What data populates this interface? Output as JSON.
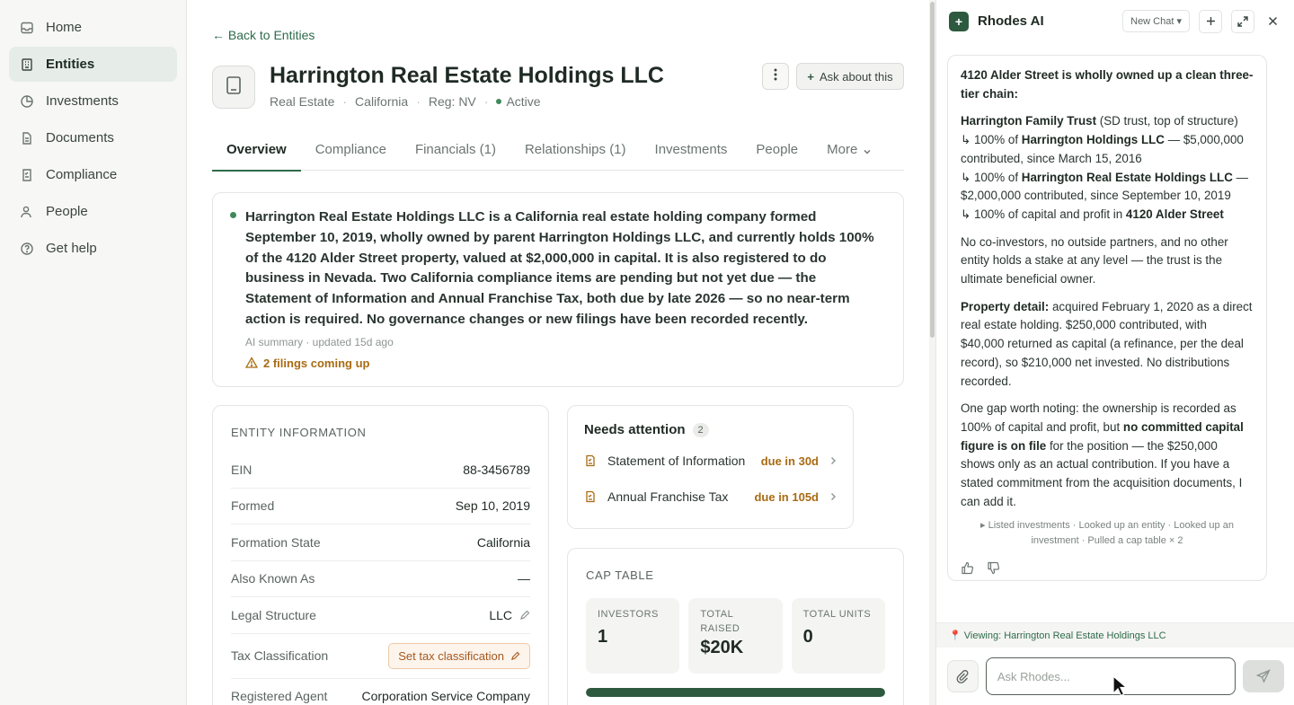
{
  "sidebar": {
    "items": [
      {
        "label": "Home",
        "icon": "inbox-icon"
      },
      {
        "label": "Entities",
        "icon": "building-icon"
      },
      {
        "label": "Investments",
        "icon": "pie-chart-icon"
      },
      {
        "label": "Documents",
        "icon": "document-icon"
      },
      {
        "label": "Compliance",
        "icon": "checklist-icon"
      },
      {
        "label": "People",
        "icon": "people-icon"
      },
      {
        "label": "Get help",
        "icon": "help-icon"
      }
    ],
    "active": "Entities"
  },
  "header": {
    "back_link": "← Back to Entities",
    "title": "Harrington Real Estate Holdings LLC",
    "meta": {
      "category": "Real Estate",
      "state": "California",
      "registration": "Reg: NV",
      "status": "Active"
    },
    "ask_button": "Ask about this"
  },
  "tabs": [
    {
      "label": "Overview"
    },
    {
      "label": "Compliance"
    },
    {
      "label": "Financials (1)"
    },
    {
      "label": "Relationships (1)"
    },
    {
      "label": "Investments"
    },
    {
      "label": "People"
    },
    {
      "label": "More"
    }
  ],
  "summary": {
    "text": "Harrington Real Estate Holdings LLC is a California real estate holding company formed September 10, 2019, wholly owned by parent Harrington Holdings LLC, and currently holds 100% of the 4120 Alder Street property, valued at $2,000,000 in capital. It is also registered to do business in Nevada. Two California compliance items are pending but not yet due — the Statement of Information and Annual Franchise Tax, both due by late 2026 — so no near-term action is required. No governance changes or new filings have been recorded recently.",
    "updated": "AI summary · updated 15d ago",
    "warning": "2 filings coming up"
  },
  "entity_info": {
    "heading": "ENTITY INFORMATION",
    "rows": [
      {
        "key": "EIN",
        "value": "88-3456789"
      },
      {
        "key": "Formed",
        "value": "Sep 10, 2019"
      },
      {
        "key": "Formation State",
        "value": "California"
      },
      {
        "key": "Also Known As",
        "value": "—"
      },
      {
        "key": "Legal Structure",
        "value": "LLC"
      },
      {
        "key": "Tax Classification",
        "value": "Set tax classification"
      },
      {
        "key": "Registered Agent",
        "value": "Corporation Service Company"
      }
    ]
  },
  "attention": {
    "title": "Needs attention",
    "count": "2",
    "items": [
      {
        "label": "Statement of Information",
        "due": "due in 30d"
      },
      {
        "label": "Annual Franchise Tax",
        "due": "due in 105d"
      }
    ]
  },
  "cap_table": {
    "heading": "CAP TABLE",
    "stats": [
      {
        "label": "INVESTORS",
        "value": "1"
      },
      {
        "label": "TOTAL RAISED",
        "value": "$20K"
      },
      {
        "label": "TOTAL UNITS",
        "value": "0"
      }
    ],
    "progress_percent": 100
  },
  "chat": {
    "title": "Rhodes AI",
    "new_chat": "New Chat ▾",
    "message": {
      "intro": "4120 Alder Street is wholly owned up a clean three-tier chain:",
      "chain": [
        {
          "pre": "",
          "bold": "Harrington Family Trust",
          "post": " (SD trust, top of structure)"
        },
        {
          "pre": "↳ 100% of ",
          "bold": "Harrington Holdings LLC",
          "post": " — $5,000,000 contributed, since March 15, 2016"
        },
        {
          "pre": "↳ 100% of ",
          "bold": "Harrington Real Estate Holdings LLC",
          "post": " — $2,000,000 contributed, since September 10, 2019"
        },
        {
          "pre": "↳ 100% of capital and profit in ",
          "bold": "4120 Alder Street",
          "post": ""
        }
      ],
      "no_coinvestors": "No co-investors, no outside partners, and no other entity holds a stake at any level — the trust is the ultimate beneficial owner.",
      "property_label": "Property detail:",
      "property_text": " acquired February 1, 2020 as a direct real estate holding. $250,000 contributed, with $40,000 returned as capital (a refinance, per the deal record), so $210,000 net invested. No distributions recorded.",
      "gap_pre": "One gap worth noting: the ownership is recorded as 100% of capital and profit, but ",
      "gap_bold": "no committed capital figure is on file",
      "gap_post": " for the position — the $250,000 shows only as an actual contribution. If you have a stated commitment from the acquisition documents, I can add it.",
      "tool_trace": "▸ Listed investments · Looked up an entity · Looked up an investment · Pulled a cap table × 2"
    },
    "viewing": "📍 Viewing: Harrington Real Estate Holdings LLC",
    "input_placeholder": "Ask Rhodes..."
  }
}
